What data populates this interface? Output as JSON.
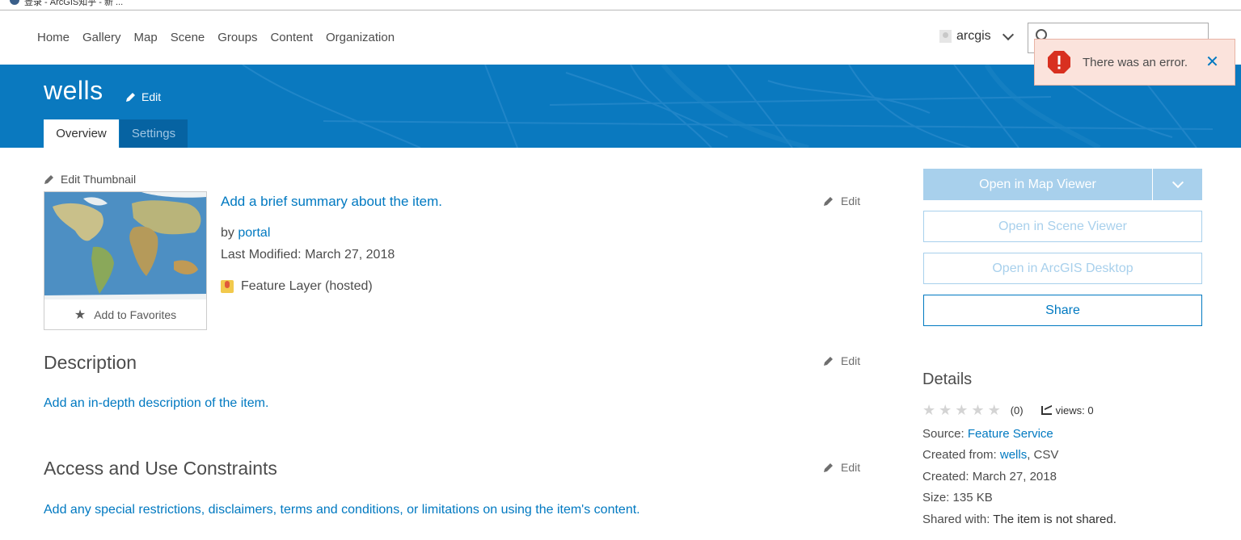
{
  "browser": {
    "tab_title": "登录 - ArcGIS知乎 - 新 ..."
  },
  "nav": {
    "items": [
      "Home",
      "Gallery",
      "Map",
      "Scene",
      "Groups",
      "Content",
      "Organization"
    ],
    "username": "arcgis",
    "search_placeholder": ""
  },
  "error_toast": {
    "message": "There was an error."
  },
  "item": {
    "title": "wells",
    "title_edit": "Edit",
    "tabs": {
      "overview": "Overview",
      "settings": "Settings"
    },
    "edit_thumbnail": "Edit Thumbnail",
    "add_to_favorites": "Add to Favorites",
    "summary_prompt": "Add a brief summary about the item.",
    "summary_edit": "Edit",
    "by_label": "by",
    "owner": "portal",
    "last_modified_label": "Last Modified:",
    "last_modified": "March 27, 2018",
    "type": "Feature Layer (hosted)"
  },
  "description": {
    "heading": "Description",
    "edit": "Edit",
    "prompt": "Add an in-depth description of the item."
  },
  "access": {
    "heading": "Access and Use Constraints",
    "edit": "Edit",
    "prompt": "Add any special restrictions, disclaimers, terms and conditions, or limitations on using the item's content."
  },
  "actions": {
    "open_map_viewer": "Open in Map Viewer",
    "open_scene_viewer": "Open in Scene Viewer",
    "open_desktop": "Open in ArcGIS Desktop",
    "share": "Share"
  },
  "details": {
    "heading": "Details",
    "rating_count": "(0)",
    "views": "views: 0",
    "rating_value": 0,
    "rating_max": 5,
    "source_label": "Source:",
    "source": "Feature Service",
    "created_from_label": "Created from:",
    "created_from_item": "wells",
    "created_from_type": ", CSV",
    "created_label": "Created:",
    "created": "March 27, 2018",
    "size_label": "Size:",
    "size": "135 KB",
    "shared_label": "Shared with:",
    "shared": "The item is not shared."
  },
  "colors": {
    "accent": "#0079c1",
    "banner": "#0a79bf",
    "disabled_button": "#a8d0ec",
    "error_bg": "#fbe3dc",
    "error_icon": "#d83020"
  }
}
